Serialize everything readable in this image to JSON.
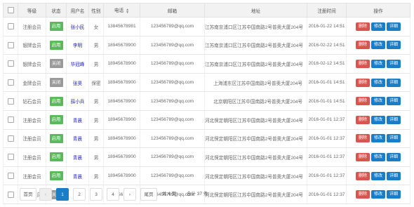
{
  "colors": {
    "normal_badge": "#5cb85c",
    "disabled_badge": "#9a9a9a",
    "delete_button": "#d9534f",
    "edit_button": "#1a7dc7",
    "detail_button": "#1a7dc7",
    "active_page": "#1a7dc7",
    "username": "#2323c8"
  },
  "table": {
    "headers": {
      "level": "等级",
      "status": "状态",
      "username": "用户名",
      "gender": "性别",
      "phone": "电话",
      "email": "邮箱",
      "address": "地址",
      "register_time": "注册时间",
      "actions": "操作"
    },
    "phone_sort_icon": "sort-icon",
    "actions": {
      "delete": "删除",
      "edit": "修改",
      "detail": "详细"
    },
    "rows": [
      {
        "level": "注册会员",
        "status": "启用",
        "status_type": "normal",
        "username": "张小民",
        "gender": "女",
        "phone": "13845678981",
        "email": "123456789@qq.com",
        "address": "江苏南京浦口区江苏中国南路2号普奥大厦204号",
        "time": "2016-01-22 14:51"
      },
      {
        "level": "银牌会员",
        "status": "启用",
        "status_type": "normal",
        "username": "李明",
        "gender": "男",
        "phone": "18945678900",
        "email": "123456789@qq.com",
        "address": "江苏南京浦口区江苏中国南路2号普奥大厦204号",
        "time": "2016-02-22 14:51"
      },
      {
        "level": "银牌会员",
        "status": "关闭",
        "status_type": "disabled",
        "username": "华冠峰",
        "gender": "男",
        "phone": "18945678900",
        "email": "123456789@qq.com",
        "address": "江苏南京浦口区江苏中国南路2号普奥大厦204号",
        "time": "2016-02-12 14:51"
      },
      {
        "level": "金牌会员",
        "status": "关闭",
        "status_type": "disabled",
        "username": "张昊",
        "gender": "保密",
        "phone": "18945678900",
        "email": "123456789@qq.com",
        "address": "上海浦东区江苏中国南路2号普奥大厦204号",
        "time": "2016-01-01 14:51"
      },
      {
        "level": "钻石会员",
        "status": "启用",
        "status_type": "normal",
        "username": "薛小兵",
        "gender": "男",
        "phone": "18945678900",
        "email": "123456789@qq.com",
        "address": "北京朝阳区江苏中国南路2号普奥大厦204号",
        "time": "2016-01-01 14:51"
      },
      {
        "level": "注册会员",
        "status": "启用",
        "status_type": "normal",
        "username": "青晨",
        "gender": "男",
        "phone": "18945678900",
        "email": "123456789@qq.com",
        "address": "河北保定朝阳区江苏中国南路2号普奥大厦204号",
        "time": "2016-01-01 12:37"
      },
      {
        "level": "注册会员",
        "status": "启用",
        "status_type": "normal",
        "username": "青晨",
        "gender": "男",
        "phone": "18945678900",
        "email": "123456789@qq.com",
        "address": "河北保定朝阳区江苏中国南路2号普奥大厦204号",
        "time": "2016-01-01 12:37"
      },
      {
        "level": "注册会员",
        "status": "启用",
        "status_type": "normal",
        "username": "青晨",
        "gender": "男",
        "phone": "18945678900",
        "email": "123456789@qq.com",
        "address": "河北保定朝阳区江苏中国南路2号普奥大厦204号",
        "time": "2016-01-01 12:37"
      },
      {
        "level": "注册会员",
        "status": "启用",
        "status_type": "normal",
        "username": "青晨",
        "gender": "男",
        "phone": "18945678900",
        "email": "123456789@qq.com",
        "address": "河北保定朝阳区江苏中国南路2号普奥大厦204号",
        "time": "2016-01-01 12:37"
      },
      {
        "level": "注册会员",
        "status": "关闭",
        "status_type": "disabled",
        "username": "青晨",
        "gender": "男",
        "phone": "18945678900",
        "email": "123456789@qq.com",
        "address": "河北保定朝阳区江苏中国南路2号普奥大厦204号",
        "time": "2016-01-01 12:37"
      }
    ]
  },
  "pagination": {
    "first": "首页",
    "prev": "‹",
    "pages": [
      "1",
      "2",
      "3",
      "4"
    ],
    "current_page": "1",
    "next": "›",
    "last": "尾页",
    "total_pages": "共 4 页",
    "total_records": "合计 37 条"
  }
}
